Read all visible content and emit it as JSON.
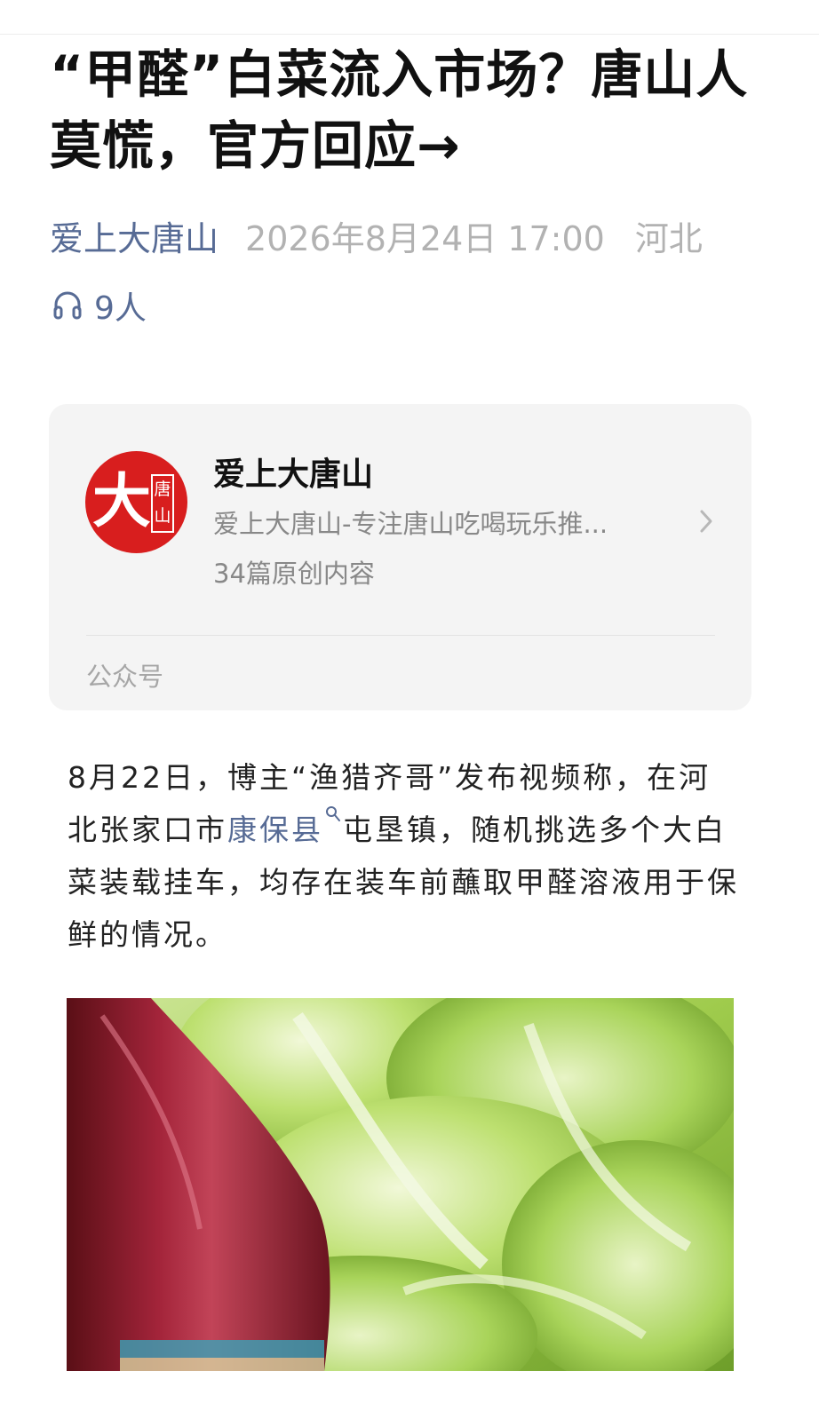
{
  "article": {
    "title": "“甲醛”白菜流入市场？唐山人莫慌，官方回应→",
    "author": "爱上大唐山",
    "date": "2026年8月24日 17:00",
    "region": "河北",
    "listeners": "9人"
  },
  "account_card": {
    "avatar_main_char": "大",
    "avatar_box_chars": "唐山",
    "name": "爱上大唐山",
    "description": "爱上大唐山-专注唐山吃喝玩乐推...",
    "original_count": "34篇原创内容",
    "type_label": "公众号"
  },
  "body": {
    "para_before": "8月22日，博主“渔猎齐哥”发布视频称，在河北张家口市",
    "link_text": "康保县",
    "para_after": "屯垦镇，随机挑选多个大白菜装载挂车，均存在装车前蘸取甲醛溶液用于保鲜的情况。"
  },
  "icons": {
    "listen": "headphones-icon",
    "card_arrow": "chevron-right-icon",
    "link_search": "search-icon"
  },
  "colors": {
    "link": "#576b95",
    "meta_gray": "#b2b2b2",
    "card_bg": "#f4f4f4",
    "avatar_red": "#d81e1e"
  }
}
